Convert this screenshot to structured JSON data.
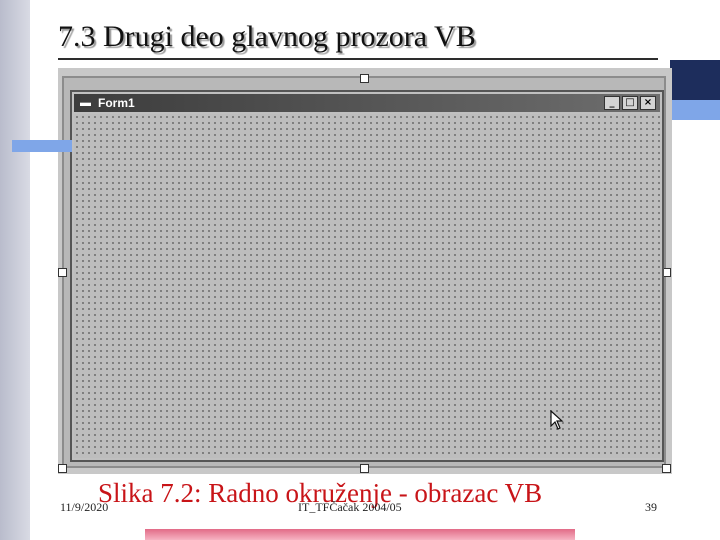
{
  "slide": {
    "title": "7.3 Drugi deo glavnog prozora VB",
    "caption": "Slika 7.2: Radno okruženje - obrazac VB",
    "footer": {
      "date": "11/9/2020",
      "center": "IT_TFČačak 2004/05",
      "page": "39"
    }
  },
  "form_window": {
    "title": "Form1",
    "icon": "form-icon",
    "buttons": {
      "minimize": "_",
      "maximize": "□",
      "close": "×"
    }
  },
  "colors": {
    "caption": "#c81418",
    "accent_blue": "#7fa6e8",
    "accent_dark": "#1d2d5c",
    "bottom_bar": "#e26b87"
  }
}
